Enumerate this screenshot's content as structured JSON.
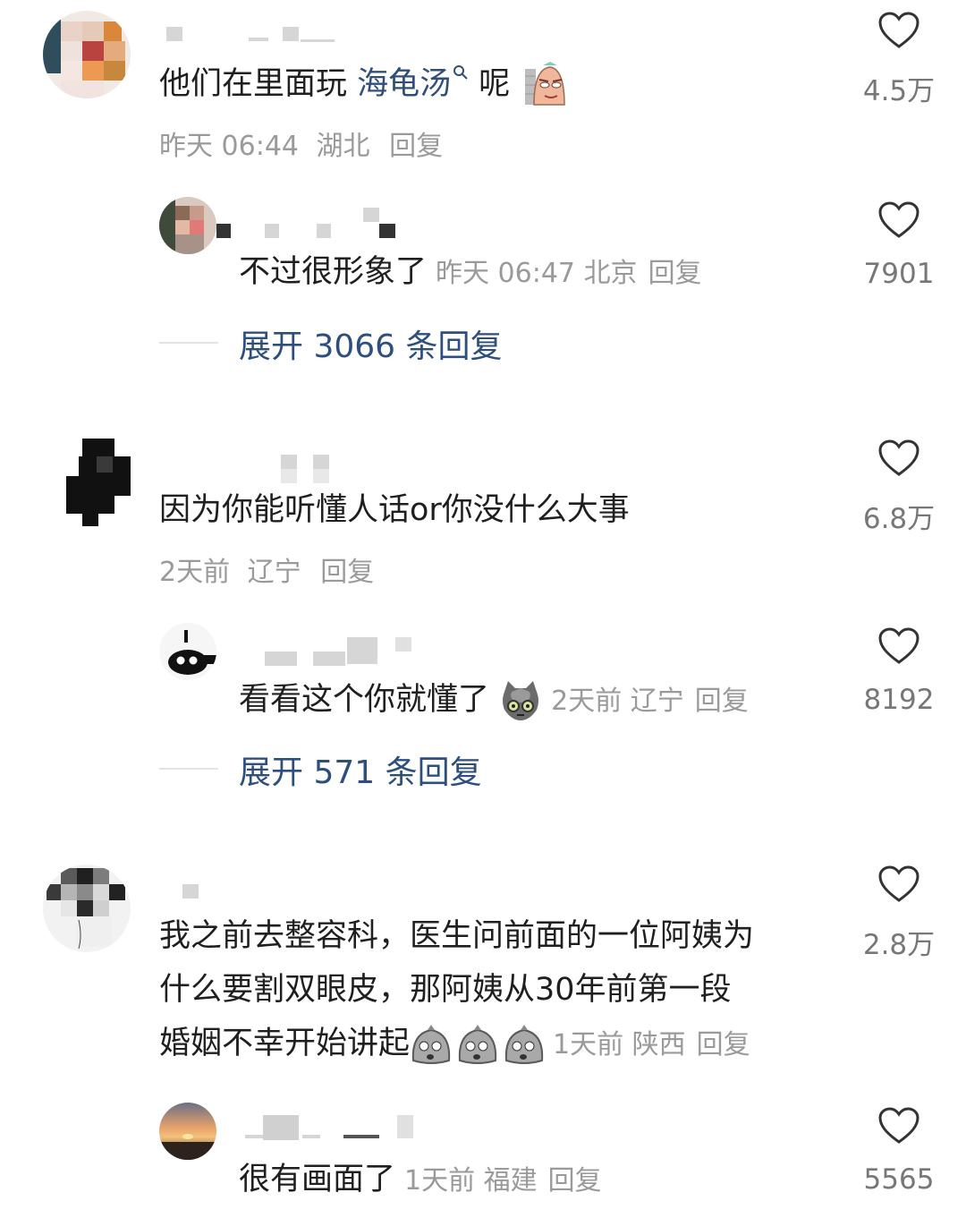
{
  "comments": [
    {
      "text_before": "他们在里面玩 ",
      "link": "海龟汤",
      "link_icon": "search-icon",
      "text_after": " 呢",
      "emoji": "doge-meme",
      "time": "昨天 06:44",
      "location": "湖北",
      "reply_label": "回复",
      "likes": "4.5万",
      "reply": {
        "text": "不过很形象了",
        "time": "昨天 06:47",
        "location": "北京",
        "reply_label": "回复",
        "likes": "7901"
      },
      "expand_label": "展开 3066 条回复"
    },
    {
      "text": "因为你能听懂人话or你没什么大事",
      "time": "2天前",
      "location": "辽宁",
      "reply_label": "回复",
      "likes": "6.8万",
      "reply": {
        "text": "看看这个你就懂了",
        "emoji": "cat-face",
        "time": "2天前",
        "location": "辽宁",
        "reply_label": "回复",
        "likes": "8192"
      },
      "expand_label": "展开 571 条回复"
    },
    {
      "line1": "我之前去整容科，医生问前面的一位阿姨为",
      "line2": "什么要割双眼皮，那阿姨从30年前第一段",
      "line3": "婚姻不幸开始讲起",
      "emoji": "shocked-face",
      "time": "1天前",
      "location": "陕西",
      "reply_label": "回复",
      "likes": "2.8万",
      "reply": {
        "text": "很有画面了",
        "time": "1天前",
        "location": "福建",
        "reply_label": "回复",
        "likes": "5565"
      }
    }
  ]
}
